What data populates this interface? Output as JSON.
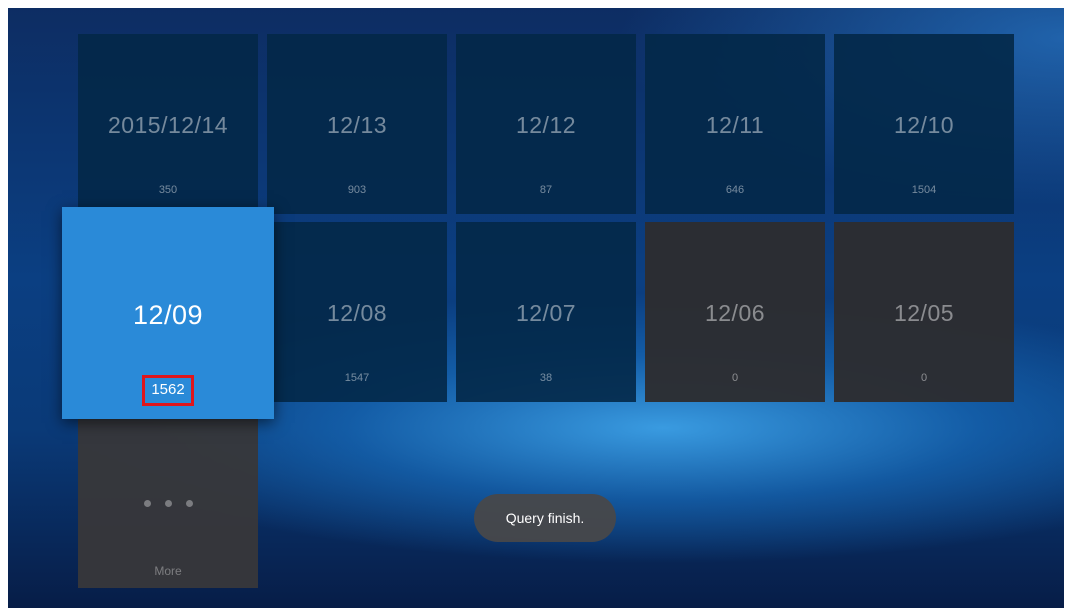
{
  "tiles_row1": [
    {
      "date": "2015/12/14",
      "count": "350"
    },
    {
      "date": "12/13",
      "count": "903"
    },
    {
      "date": "12/12",
      "count": "87"
    },
    {
      "date": "12/11",
      "count": "646"
    },
    {
      "date": "12/10",
      "count": "1504"
    }
  ],
  "tiles_row2": [
    {
      "date": "12/09",
      "count": "1562"
    },
    {
      "date": "12/08",
      "count": "1547"
    },
    {
      "date": "12/07",
      "count": "38"
    },
    {
      "date": "12/06",
      "count": "0"
    },
    {
      "date": "12/05",
      "count": "0"
    }
  ],
  "more": {
    "label": "More",
    "icon": "more-dots-icon"
  },
  "toast": {
    "text": "Query finish."
  },
  "colors": {
    "selected_tile": "#2a8ad8",
    "tile": "#032848",
    "empty_tile": "#2d2d30",
    "highlight_box": "#e0161c"
  }
}
